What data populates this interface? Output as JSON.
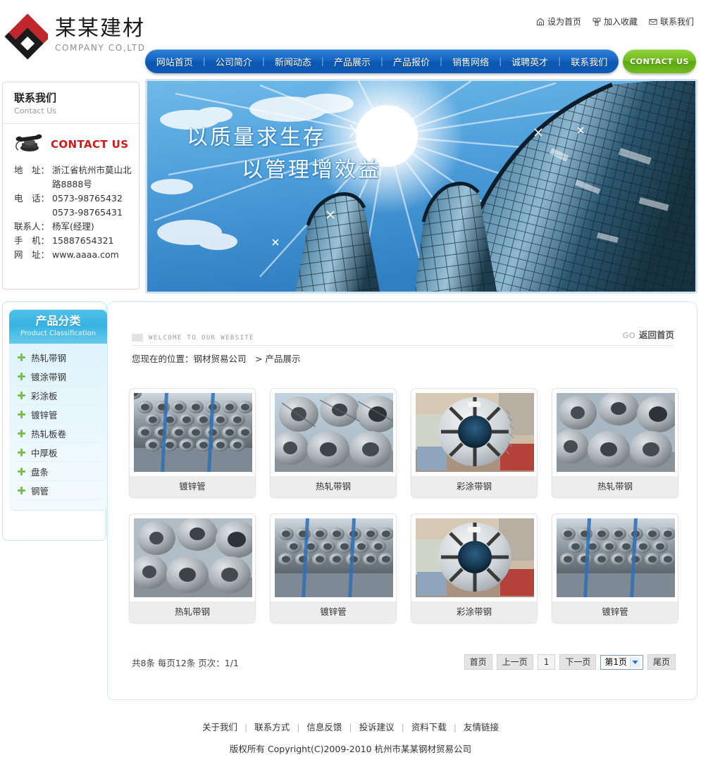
{
  "header": {
    "top_links": [
      {
        "icon": "home-icon",
        "label": "设为首页"
      },
      {
        "icon": "star-favorite-icon",
        "label": "加入收藏"
      },
      {
        "icon": "mail-icon",
        "label": "联系我们"
      }
    ],
    "logo_cn": "某某建材",
    "logo_en": "COMPANY CO,LTD",
    "nav": [
      "网站首页",
      "公司简介",
      "新闻动态",
      "产品展示",
      "产品报价",
      "销售网络",
      "诚聘英才",
      "联系我们"
    ],
    "nav_separator": "|",
    "contact_button": "CONTACT US"
  },
  "contact_panel": {
    "title_cn": "联系我们",
    "title_en": "Contact Us",
    "logo_text": "CONTACT US",
    "rows": [
      {
        "label": "地　址：",
        "value": "浙江省杭州市莫山北"
      },
      {
        "label": "",
        "value": "路8888号"
      },
      {
        "label": "电　话：",
        "value": "0573-98765432"
      },
      {
        "label": "",
        "value": "0573-98765431"
      },
      {
        "label": "联系人：",
        "value": "杨军(经理)"
      },
      {
        "label": "手　机：",
        "value": "15887654321"
      },
      {
        "label": "网　址：",
        "value": "www.aaaa.com"
      }
    ]
  },
  "banner": {
    "line1": "以质量求生存",
    "line2": "以管理增效益"
  },
  "sidebar": {
    "title_cn": "产品分类",
    "title_en": "Product Classification",
    "items": [
      "热轧带钢",
      "镀涂带钢",
      "彩涂板",
      "镀锌管",
      "热轧板卷",
      "中厚板",
      "盘条",
      "钢管"
    ]
  },
  "main": {
    "welcome": "WELCOME TO OUR WEBSITE",
    "go_label": "GO",
    "back_home": "返回首页",
    "breadcrumb": "您现在的位置：钢材贸易公司　> 产品展示",
    "products": [
      {
        "caption": "镀锌管",
        "image": "galvanized-pipes"
      },
      {
        "caption": "热轧带钢",
        "image": "steel-coils"
      },
      {
        "caption": "彩涂带钢",
        "image": "color-coated-coil"
      },
      {
        "caption": "热轧带钢",
        "image": "steel-coils"
      },
      {
        "caption": "热轧带钢",
        "image": "steel-coils"
      },
      {
        "caption": "镀锌管",
        "image": "galvanized-pipes"
      },
      {
        "caption": "彩涂带钢",
        "image": "color-coated-coil"
      },
      {
        "caption": "镀锌管",
        "image": "galvanized-pipes"
      }
    ],
    "pager": {
      "info": "共8条  每页12条  页次：1/1",
      "first": "首页",
      "prev": "上一页",
      "current": "1",
      "next": "下一页",
      "select_value": "第1页",
      "last": "尾页"
    }
  },
  "footer": {
    "links": [
      "关于我们",
      "联系方式",
      "信息反馈",
      "投诉建议",
      "资料下载",
      "友情链接"
    ],
    "separator": "|",
    "copyright": "版权所有  Copyright(C)2009-2010 杭州市某某钢材贸易公司"
  },
  "colors": {
    "nav_blue": "#0b56b0",
    "accent_green": "#6fba1e",
    "sidebar_cyan": "#37b3e2",
    "contact_red": "#cf1a1a",
    "plus_green": "#7ac043"
  }
}
